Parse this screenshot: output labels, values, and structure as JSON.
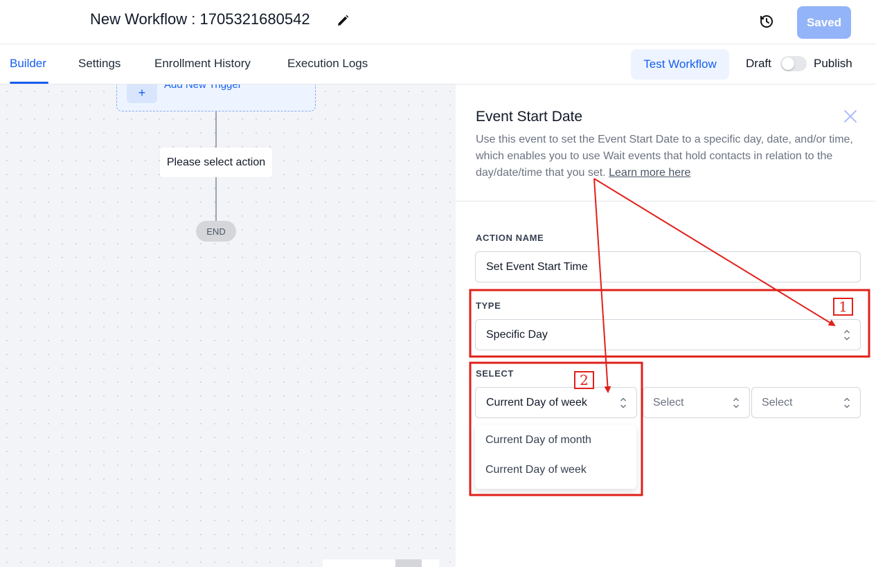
{
  "header": {
    "workflow_title": "New Workflow : 1705321680542",
    "saved_label": "Saved"
  },
  "tabs": [
    "Builder",
    "Settings",
    "Enrollment History",
    "Execution Logs"
  ],
  "active_tab": "Builder",
  "toolbar": {
    "test_label": "Test Workflow",
    "draft_label": "Draft",
    "publish_label": "Publish",
    "publish_on": false
  },
  "canvas": {
    "trigger_label": "Add New Trigger",
    "action_label": "Please select action",
    "end_label": "END"
  },
  "panel": {
    "title": "Event Start Date",
    "description": "Use this event to set the Event Start Date to a specific day, date, and/or time, which enables you to use Wait events that hold contacts in relation to the day/date/time that you set.",
    "learn_more": "Learn more here",
    "action_name_label": "ACTION NAME",
    "action_name_value": "Set Event Start Time",
    "type_label": "TYPE",
    "type_value": "Specific Day",
    "select_label": "SELECT",
    "select_1_value": "Current Day of week",
    "select_2_placeholder": "Select",
    "select_3_placeholder": "Select",
    "dropdown_options": [
      "Current Day of month",
      "Current Day of week"
    ]
  },
  "annotations": {
    "label_1": "1",
    "label_2": "2",
    "color": "#e0201a"
  },
  "colors": {
    "accent": "#155eef",
    "saved_button": "#93b4f8"
  }
}
